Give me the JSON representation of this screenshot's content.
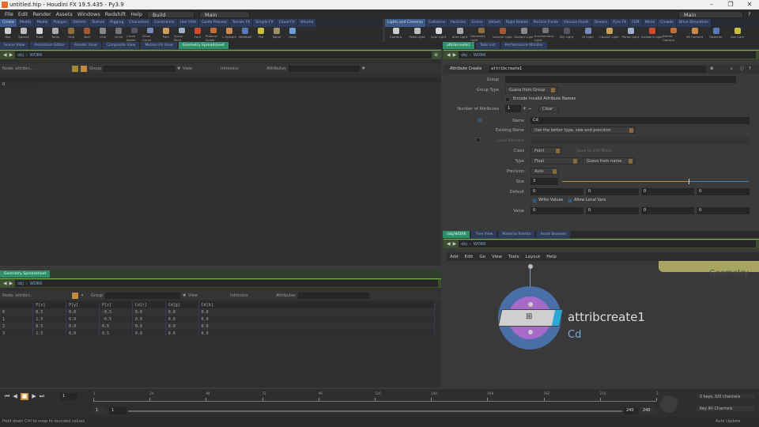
{
  "window": {
    "title": "untitled.hip - Houdini FX 19.5.435 - Py3.9",
    "controls": [
      "–",
      "❐",
      "✕"
    ]
  },
  "menu": {
    "items": [
      "File",
      "Edit",
      "Render",
      "Assets",
      "Windows",
      "Redshift",
      "Help"
    ],
    "desktop_left": "Build",
    "desktop_main": "Main",
    "desktop_right": "Main"
  },
  "shelf_left": {
    "tabs": [
      "Create",
      "Modify",
      "Model",
      "Polygon",
      "Deform",
      "Texture",
      "Rigging",
      "Characters",
      "Constraints",
      "Hair Utils",
      "Guide Process",
      "Terrain FX",
      "Simple FX",
      "Cloud FX",
      "Volume"
    ],
    "tools": [
      "Box",
      "Sphere",
      "Tube",
      "Torus",
      "Grid",
      "Null",
      "Line",
      "Circle",
      "Curve Bezier",
      "Draw Curve",
      "Path",
      "Spray Paint",
      "Font",
      "Platonic Solids",
      "L-System",
      "Metaball",
      "File",
      "Spiral",
      "Helix"
    ]
  },
  "shelf_right": {
    "tabs": [
      "Lights and Cameras",
      "Collisions",
      "Particles",
      "Grains",
      "Vellum",
      "Rigid Bodies",
      "Particle Fluids",
      "Viscous Fluids",
      "Oceans",
      "Pyro FX",
      "FEM",
      "Wires",
      "Crowds",
      "Drive Simulation"
    ],
    "tools": [
      "Camera",
      "Point Light",
      "Spot Light",
      "Area Light",
      "Geometry Light",
      "Volume Light",
      "Distant Light",
      "Environment Light",
      "Sky Light",
      "GI Light",
      "Caustic Light",
      "Portal Light",
      "Ambient Light",
      "Stereo Camera",
      "VR Camera",
      "Switcher",
      "Gas Cam"
    ]
  },
  "pane_tabs_left": [
    "Scene View",
    "Animation Editor",
    "Render View",
    "Composite View",
    "Motion FX View",
    "Geometry Spreadsheet"
  ],
  "pane_tabs_right_top": [
    "attribcreate1",
    "Take List",
    "Performance Monitor"
  ],
  "pane_tabs_right_bottom": [
    "/obj/WORK",
    "Tree View",
    "Material Palette",
    "Asset Browser"
  ],
  "pane_tabs_bottom_left": [
    "Geometry Spreadsheet"
  ],
  "path": {
    "root": "obj",
    "node": "WORK"
  },
  "spreadsheet_top": {
    "node_label": "Node: attribcr...",
    "group": "Group",
    "view": "View",
    "intrinsics": "Intrinsics",
    "attributes": "Attributes",
    "rows": [
      "0"
    ]
  },
  "spreadsheet_bottom": {
    "node_label": "Node: attribcr...",
    "group": "Group",
    "view": "View",
    "intrinsics": "Intrinsics",
    "attributes": "Attributes",
    "columns": [
      "",
      "P[x]",
      "P[y]",
      "P[z]",
      "Cd[r]",
      "Cd[g]",
      "Cd[b]"
    ],
    "rows": [
      [
        "0",
        "0.5",
        "0.0",
        "-0.5",
        "0.0",
        "0.0",
        "0.0"
      ],
      [
        "1",
        "1.5",
        "0.0",
        "-0.5",
        "0.0",
        "0.0",
        "0.0"
      ],
      [
        "2",
        "0.5",
        "0.0",
        "0.5",
        "0.0",
        "0.0",
        "0.0"
      ],
      [
        "3",
        "1.5",
        "0.0",
        "0.5",
        "0.0",
        "0.0",
        "0.0"
      ]
    ]
  },
  "params": {
    "node_type": "Attribute Create",
    "node_name": "attribcreate1",
    "group_label": "Group",
    "group_value": "",
    "group_type_label": "Group Type",
    "group_type": "Guess from Group",
    "encode_label": "Encode Invalid Attribute Names",
    "num_attr_label": "Number of Attributes",
    "num_attr": "1",
    "clear": "Clear",
    "name_label": "Name",
    "name": "Cd",
    "existing_label": "Existing Name",
    "existing": "Use the better type, size and precision",
    "local_label": "Local Variable",
    "class_label": "Class",
    "class": "Point",
    "save_label": "Save to Info Block",
    "type_label": "Type",
    "type": "Float",
    "type_info": "Guess from name",
    "precision_label": "Precision",
    "precision": "Auto",
    "size_label": "Size",
    "size": "3",
    "size_slider_fraction": 0.68,
    "default_label": "Default",
    "default": [
      "0",
      "0",
      "0",
      "0"
    ],
    "write_label": "Write Values",
    "allow_label": "Allow Local Vars",
    "value_label": "Value",
    "value": [
      "0",
      "0",
      "0",
      "0"
    ]
  },
  "network": {
    "menu": [
      "Add",
      "Edit",
      "Go",
      "View",
      "Tools",
      "Layout",
      "Help"
    ],
    "node_name": "attribcreate1",
    "node_comment": "Cd",
    "context_label": "Geometry"
  },
  "timeline": {
    "ticks": [
      "1",
      "24",
      "48",
      "72",
      "96",
      "120",
      "144",
      "168",
      "192",
      "216",
      "2"
    ],
    "frame": "1",
    "start": "1",
    "start2": "1",
    "end": "240",
    "end2": "240",
    "keys": "0 keys, 0/0 channels",
    "key_all": "Key All Channels"
  },
  "status": {
    "message": "Hold down Ctrl to snap to rounded values",
    "auto_update": "Auto Update"
  }
}
